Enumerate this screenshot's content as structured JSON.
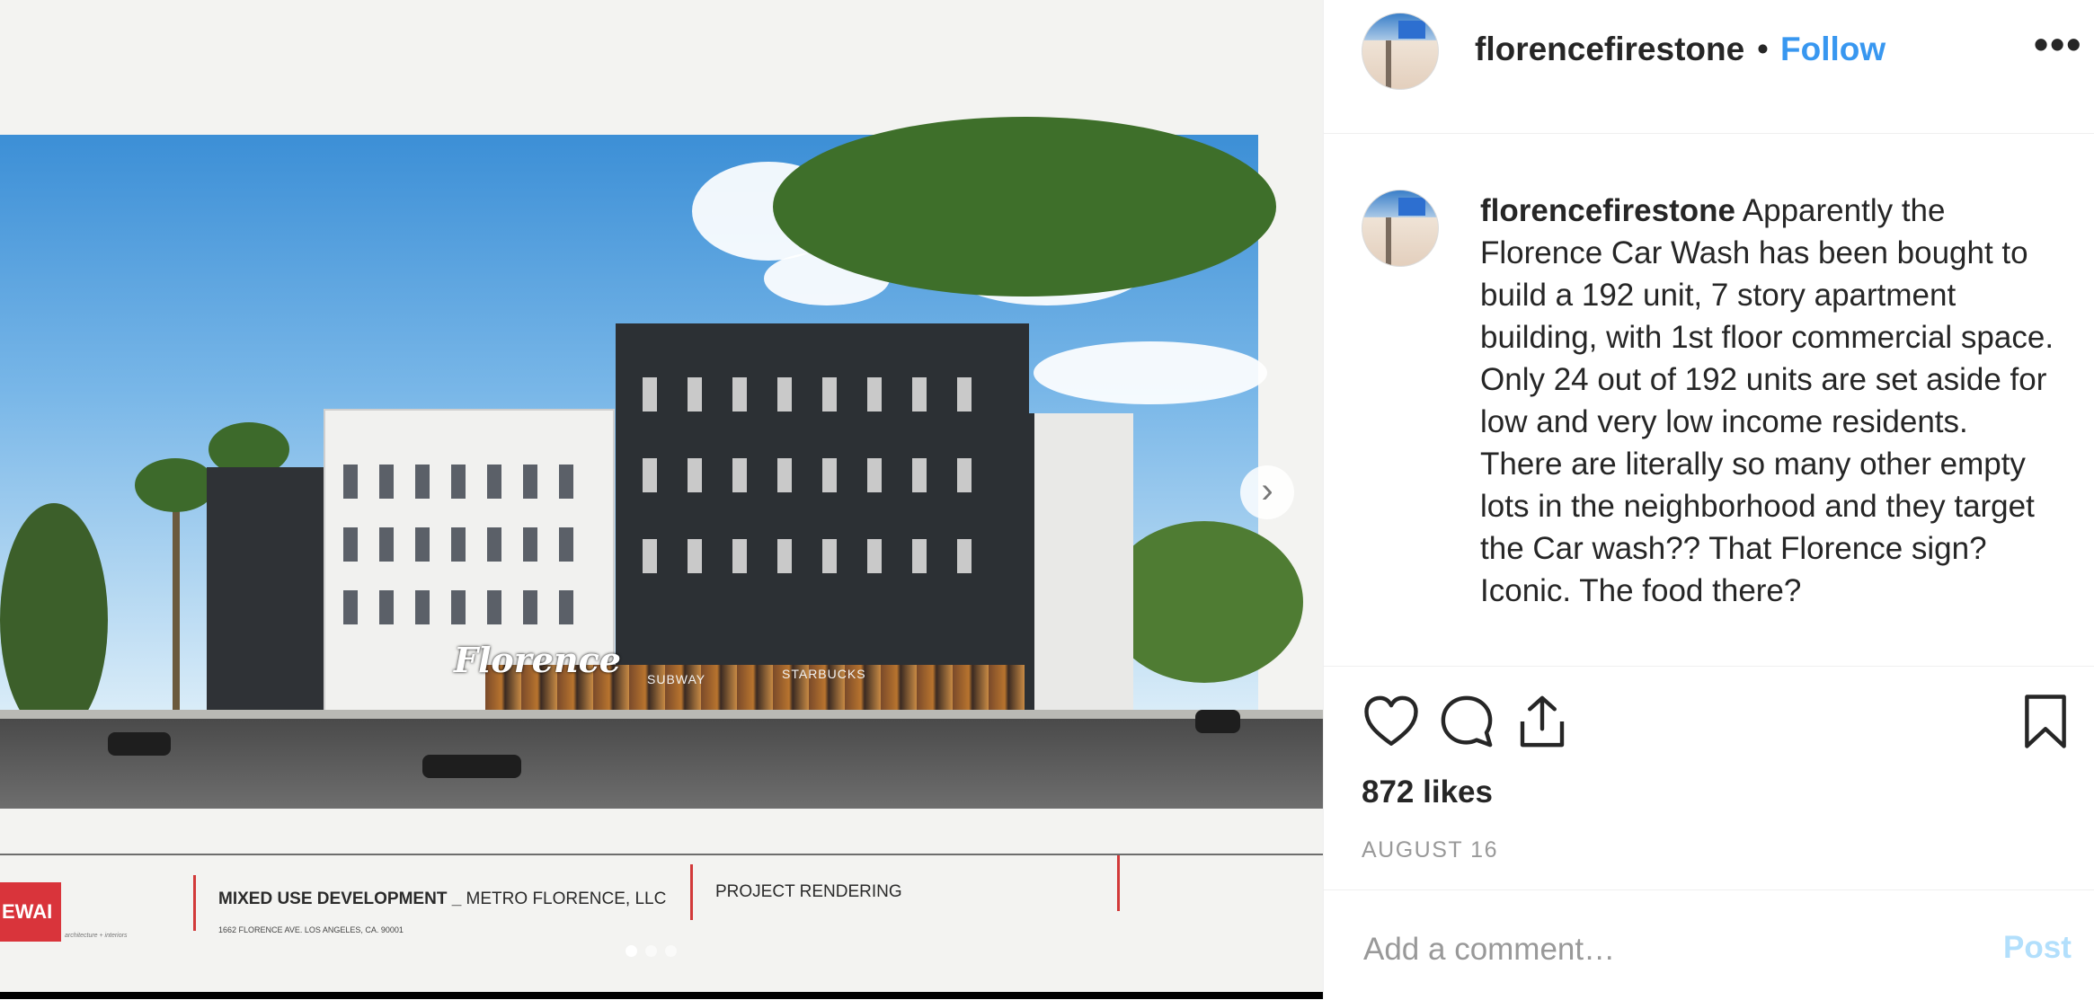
{
  "post": {
    "username": "florencefirestone",
    "separator": "•",
    "follow_label": "Follow",
    "more_label": "•••",
    "caption_user": "florencefirestone",
    "caption_text": " Apparently the Florence Car Wash has been bought to build a 192 unit, 7 story apartment building, with 1st floor commercial space. Only 24 out of 192 units are set aside for low and very low income residents.\nThere are literally so many other empty lots in the neighborhood and they target the Car wash?? That Florence sign? Iconic. The food there?",
    "likes": "872 likes",
    "date": "AUGUST 16",
    "comment_placeholder": "Add a comment…",
    "post_label": "Post"
  },
  "photo": {
    "sign_text": "Florence",
    "store_1": "SUBWAY",
    "store_2": "STARBUCKS",
    "logo_text": "EWAI",
    "logo_sub": "architecture + interiors",
    "doc_title_bold": "MIXED USE DEVELOPMENT _",
    "doc_title_rest": " METRO FLORENCE, LLC",
    "doc_address": "1662 FLORENCE AVE. LOS ANGELES, CA. 90001",
    "doc_rendering": "PROJECT RENDERING",
    "next_label": "›",
    "carousel": {
      "count": 3,
      "active": 1
    }
  },
  "colors": {
    "accent": "#3897f0",
    "post_disabled": "#b2dffc",
    "muted": "#999999",
    "text": "#262626",
    "logo_red": "#d9343b"
  },
  "icons": [
    "heart-icon",
    "comment-icon",
    "share-icon",
    "bookmark-icon",
    "next-icon",
    "more-icon"
  ]
}
